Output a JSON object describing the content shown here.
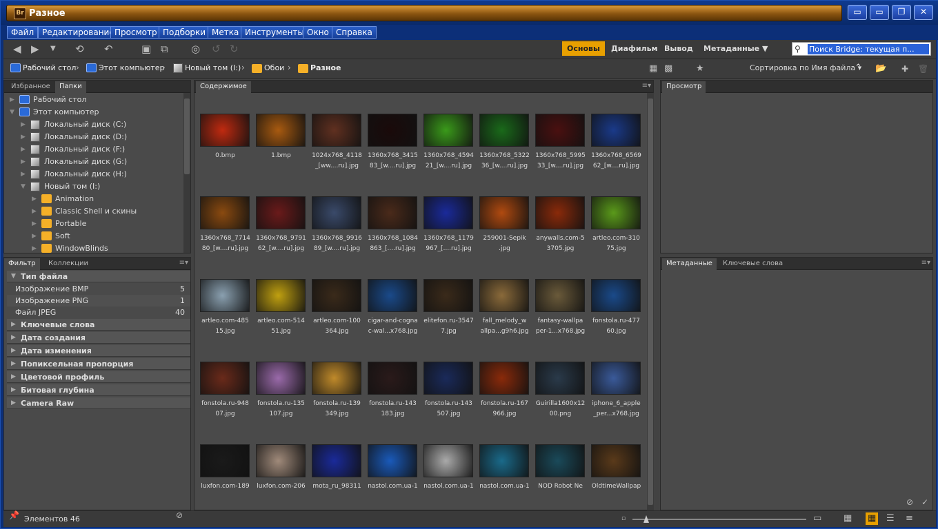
{
  "window": {
    "title": "Разное",
    "app_logo": "Br"
  },
  "menu": [
    "Файл",
    "Редактирование",
    "Просмотр",
    "Подборки",
    "Метка",
    "Инструменты",
    "Окно",
    "Справка"
  ],
  "workspaces": [
    "Основы",
    "Диафильм",
    "Вывод",
    "Метаданные"
  ],
  "search": {
    "placeholder": "Поиск Bridge: текущая п..."
  },
  "breadcrumb": [
    "Рабочий стол",
    "Этот компьютер",
    "Новый том (I:)",
    "Обои",
    "Разное"
  ],
  "sort": {
    "label": "Сортировка по Имя файла"
  },
  "left_top_tabs": [
    "Избранное",
    "Папки"
  ],
  "tree": [
    {
      "label": "Рабочий стол",
      "kind": "pc",
      "level": 0
    },
    {
      "label": "Этот компьютер",
      "kind": "pc",
      "level": 0
    },
    {
      "label": "Локальный диск (C:)",
      "kind": "drive",
      "level": 1
    },
    {
      "label": "Локальный диск (D:)",
      "kind": "drive",
      "level": 1
    },
    {
      "label": "Локальный диск (F:)",
      "kind": "drive",
      "level": 1
    },
    {
      "label": "Локальный диск (G:)",
      "kind": "drive",
      "level": 1
    },
    {
      "label": "Локальный диск (H:)",
      "kind": "drive",
      "level": 1
    },
    {
      "label": "Новый том (I:)",
      "kind": "drive",
      "level": 1
    },
    {
      "label": "Animation",
      "kind": "folder",
      "level": 2
    },
    {
      "label": "Classic Shell и скины",
      "kind": "folder",
      "level": 2
    },
    {
      "label": "Portable",
      "kind": "folder",
      "level": 2
    },
    {
      "label": "Soft",
      "kind": "folder",
      "level": 2
    },
    {
      "label": "WindowBlinds",
      "kind": "folder",
      "level": 2
    }
  ],
  "filter_tabs": [
    "Фильтр",
    "Коллекции"
  ],
  "filter": {
    "file_type_title": "Тип файла",
    "file_types": [
      {
        "label": "Изображение BMP",
        "count": "5"
      },
      {
        "label": "Изображение PNG",
        "count": "1"
      },
      {
        "label": "Файл JPEG",
        "count": "40"
      }
    ],
    "groups": [
      "Ключевые слова",
      "Дата создания",
      "Дата изменения",
      "Попиксельная пропорция",
      "Цветовой профиль",
      "Битовая глубина",
      "Camera Raw"
    ]
  },
  "content_tab": "Содержимое",
  "preview_tab": "Просмотр",
  "meta_tabs": [
    "Метаданные",
    "Ключевые слова"
  ],
  "thumbnails": [
    {
      "l1": "0.bmp",
      "l2": "",
      "c": "#c02a10"
    },
    {
      "l1": "1.bmp",
      "l2": "",
      "c": "#a85a10"
    },
    {
      "l1": "1024x768_4118",
      "l2": "_[ww....ru].jpg",
      "c": "#603020"
    },
    {
      "l1": "1360x768_3415",
      "l2": "83_[w....ru].jpg",
      "c": "#1a0a0a"
    },
    {
      "l1": "1360x768_4594",
      "l2": "21_[w....ru].jpg",
      "c": "#3a9a1a"
    },
    {
      "l1": "1360x768_5322",
      "l2": "36_[w....ru].jpg",
      "c": "#1a6a1a"
    },
    {
      "l1": "1360x768_5995",
      "l2": "33_[w....ru].jpg",
      "c": "#4a1010"
    },
    {
      "l1": "1360x768_6569",
      "l2": "62_[w....ru].jpg",
      "c": "#1a3a8a"
    },
    {
      "l1": "1360x768_7714",
      "l2": "80_[w....ru].jpg",
      "c": "#8a4a10"
    },
    {
      "l1": "1360x768_9791",
      "l2": "62_[w....ru].jpg",
      "c": "#6a1a1a"
    },
    {
      "l1": "1360x768_9916",
      "l2": "89_[w....ru].jpg",
      "c": "#3a4a6a"
    },
    {
      "l1": "1360x768_1084",
      "l2": "863_[....ru].jpg",
      "c": "#4a2a1a"
    },
    {
      "l1": "1360x768_1179",
      "l2": "967_[....ru].jpg",
      "c": "#1a2a9a"
    },
    {
      "l1": "259001-Sepik",
      "l2": ".jpg",
      "c": "#b04a10"
    },
    {
      "l1": "anywalls.com-5",
      "l2": "3705.jpg",
      "c": "#8a2a0a"
    },
    {
      "l1": "artleo.com-310",
      "l2": "75.jpg",
      "c": "#5a9a1a"
    },
    {
      "l1": "artleo.com-485",
      "l2": "15.jpg",
      "c": "#8aa0b0"
    },
    {
      "l1": "artleo.com-514",
      "l2": "51.jpg",
      "c": "#c0a010"
    },
    {
      "l1": "artleo.com-100",
      "l2": "364.jpg",
      "c": "#3a2a1a"
    },
    {
      "l1": "cigar-and-cogna",
      "l2": "c-wal...x768.jpg",
      "c": "#1a4a8a"
    },
    {
      "l1": "elitefon.ru-3547",
      "l2": "7.jpg",
      "c": "#3a2a1a"
    },
    {
      "l1": "fall_melody_w",
      "l2": "allpa...g9h6.jpg",
      "c": "#8a6a3a"
    },
    {
      "l1": "fantasy-wallpa",
      "l2": "per-1...x768.jpg",
      "c": "#6a5a3a"
    },
    {
      "l1": "fonstola.ru-477",
      "l2": "60.jpg",
      "c": "#1a4a8a"
    },
    {
      "l1": "fonstola.ru-948",
      "l2": "07.jpg",
      "c": "#6a2a1a"
    },
    {
      "l1": "fonstola.ru-135",
      "l2": "107.jpg",
      "c": "#9a6aaa"
    },
    {
      "l1": "fonstola.ru-139",
      "l2": "349.jpg",
      "c": "#c08a2a"
    },
    {
      "l1": "fonstola.ru-143",
      "l2": "183.jpg",
      "c": "#2a1a1a"
    },
    {
      "l1": "fonstola.ru-143",
      "l2": "507.jpg",
      "c": "#1a2a5a"
    },
    {
      "l1": "fonstola.ru-167",
      "l2": "966.jpg",
      "c": "#8a2a0a"
    },
    {
      "l1": "Guirilla1600x12",
      "l2": "00.png",
      "c": "#2a3a4a"
    },
    {
      "l1": "iphone_6_apple",
      "l2": "_per...x768.jpg",
      "c": "#3a5a9a"
    },
    {
      "l1": "luxfon.com-189",
      "l2": "",
      "c": "#1a1a1a"
    },
    {
      "l1": "luxfon.com-206",
      "l2": "",
      "c": "#a08a7a"
    },
    {
      "l1": "mota_ru_98311",
      "l2": "",
      "c": "#1a2a9a"
    },
    {
      "l1": "nastol.com.ua-1",
      "l2": "",
      "c": "#1a5aba"
    },
    {
      "l1": "nastol.com.ua-1",
      "l2": "",
      "c": "#aaaaaa"
    },
    {
      "l1": "nastol.com.ua-1",
      "l2": "",
      "c": "#1a6a8a"
    },
    {
      "l1": "NOD Robot Ne",
      "l2": "",
      "c": "#1a4a5a"
    },
    {
      "l1": "OldtimeWallpap",
      "l2": "",
      "c": "#5a3a1a"
    }
  ],
  "status": {
    "count": "Элементов 46"
  }
}
